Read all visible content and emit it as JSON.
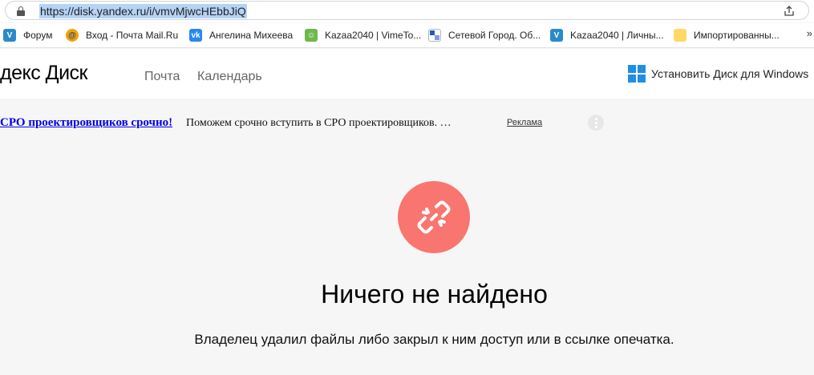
{
  "browser": {
    "url": "https://disk.yandex.ru/i/vmvMjwcHEbbJiQ",
    "icons": {
      "lock": "lock-icon",
      "share": "share-icon"
    }
  },
  "bookmarks": [
    {
      "label": "Форум",
      "icon": "shield-icon",
      "glyph": ""
    },
    {
      "label": "Вход - Почта Mail.Ru",
      "icon": "mail-ru-icon",
      "glyph": "@"
    },
    {
      "label": "Ангелина Михеева",
      "icon": "vk-icon",
      "glyph": "vk"
    },
    {
      "label": "Kazaa2040 | VimeTo...",
      "icon": "android-icon",
      "glyph": ""
    },
    {
      "label": "Сетевой Город. Об...",
      "icon": "grid-icon",
      "glyph": ""
    },
    {
      "label": "Kazaa2040 | Личны...",
      "icon": "shield-icon",
      "glyph": ""
    },
    {
      "label": "Импортированны...",
      "icon": "folder-icon",
      "glyph": ""
    }
  ],
  "bookmarks_overflow": "»",
  "header": {
    "logo": "декс Диск",
    "nav": [
      "Почта",
      "Календарь"
    ],
    "install_label": "Установить Диск для Windows"
  },
  "ad": {
    "headline": "СРО проектировщиков срочно!",
    "text": "Поможем срочно вступить в СРО проектировщиков. …",
    "label": "Реклама"
  },
  "empty_state": {
    "icon": "broken-link-icon",
    "accent_color": "#f97570",
    "title": "Ничего не найдено",
    "message": "Владелец удалил файлы либо закрыл к ним доступ или в ссылке опечатка."
  }
}
